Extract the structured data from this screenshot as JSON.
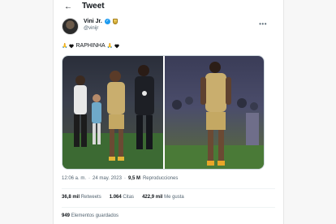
{
  "header": {
    "back_icon": "arrow-left-icon",
    "title": "Tweet"
  },
  "author": {
    "name": "Vini Jr.",
    "handle": "@vinijr",
    "verified_icon": "verified-badge-icon",
    "affiliate_icon": "club-crest-icon"
  },
  "tweet": {
    "text_icons": [
      "praying-hands-icon",
      "black-heart-icon"
    ],
    "text": "RAPHINHA",
    "text_icons_after": [
      "praying-hands-icon",
      "black-heart-icon"
    ]
  },
  "media": {
    "photos": [
      "photo-1",
      "photo-2"
    ]
  },
  "meta": {
    "time": "12:06 a. m.",
    "separator": "·",
    "date": "24 may. 2023",
    "views_value": "9,5 M",
    "views_label": "Reproducciones"
  },
  "stats": {
    "retweets_value": "36,8 mil",
    "retweets_label": "Retweets",
    "quotes_value": "1.064",
    "quotes_label": "Citas",
    "likes_value": "422,9 mil",
    "likes_label": "Me gusta"
  },
  "bookmarks": {
    "value": "949",
    "label": "Elementos guardados"
  },
  "colors": {
    "accent": "#1d9bf0",
    "text": "#0f1419",
    "secondary": "#536471"
  }
}
